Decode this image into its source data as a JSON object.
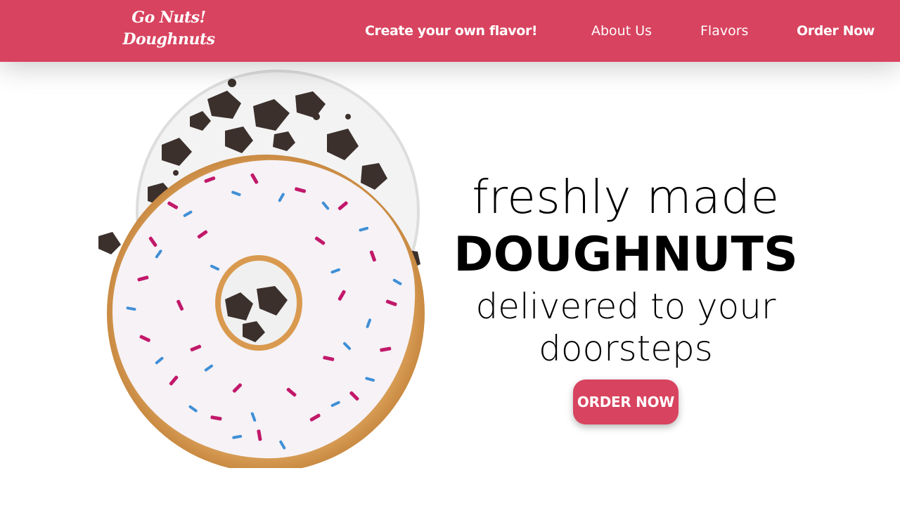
{
  "brand": {
    "line1": "Go Nuts!",
    "line2": "Doughnuts",
    "color": "#d8435f"
  },
  "nav": {
    "create": "Create your own flavor!",
    "about": "About Us",
    "flavors": "Flavors",
    "order": "Order Now"
  },
  "hero": {
    "line1": "freshly made",
    "line2": "DOUGHNUTS",
    "line3": "delivered to your",
    "line4": "doorsteps",
    "cta": "ORDER NOW"
  }
}
